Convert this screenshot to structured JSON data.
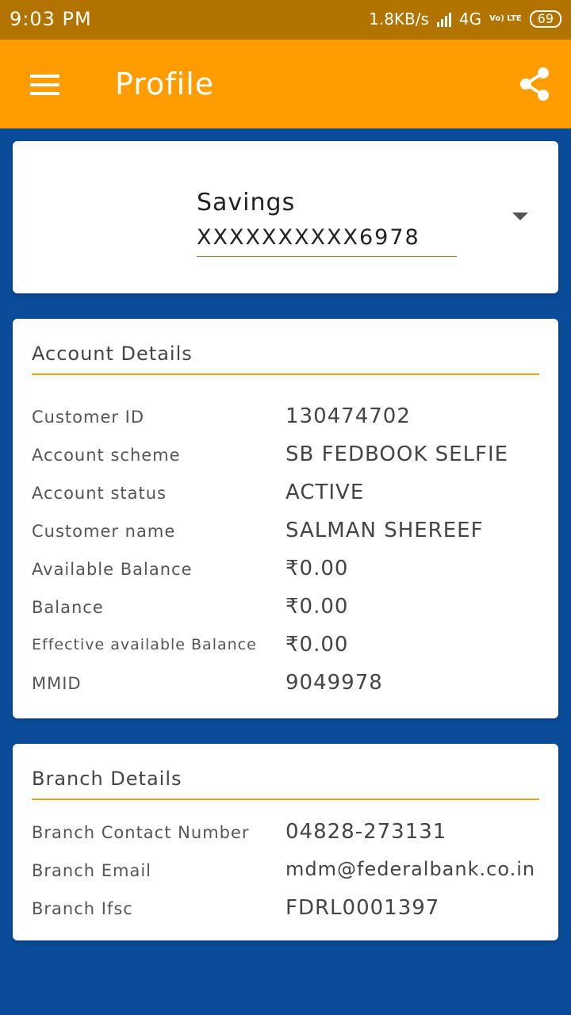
{
  "status_bar": {
    "time": "9:03 PM",
    "network_speed": "1.8KB/s",
    "network_type": "4G",
    "volte_label": "Vo) LTE",
    "battery": "69"
  },
  "app_bar": {
    "title": "Profile",
    "menu_icon": "menu-icon",
    "share_icon": "share-icon"
  },
  "account_selector": {
    "type": "Savings",
    "number": "XXXXXXXXXX6978"
  },
  "account_details": {
    "title": "Account Details",
    "rows": [
      {
        "label": "Customer ID",
        "value": "130474702"
      },
      {
        "label": "Account scheme",
        "value": "SB FEDBOOK SELFIE"
      },
      {
        "label": "Account status",
        "value": "ACTIVE"
      },
      {
        "label": "Customer name",
        "value": "SALMAN SHEREEF"
      },
      {
        "label": "Available Balance",
        "value": "₹0.00"
      },
      {
        "label": "Balance",
        "value": "₹0.00"
      },
      {
        "label": "Effective available Balance",
        "value": "₹0.00"
      },
      {
        "label": "MMID",
        "value": "9049978"
      }
    ]
  },
  "branch_details": {
    "title": "Branch Details",
    "rows": [
      {
        "label": "Branch Contact Number",
        "value": "04828-273131"
      },
      {
        "label": "Branch Email",
        "value": "mdm@federalbank.co.in"
      },
      {
        "label": "Branch Ifsc",
        "value": "FDRL0001397"
      }
    ]
  },
  "colors": {
    "background": "#0a4c99",
    "app_bar": "#ff9c00",
    "status_bar": "#b27300",
    "accent_rule": "#f0a020"
  }
}
